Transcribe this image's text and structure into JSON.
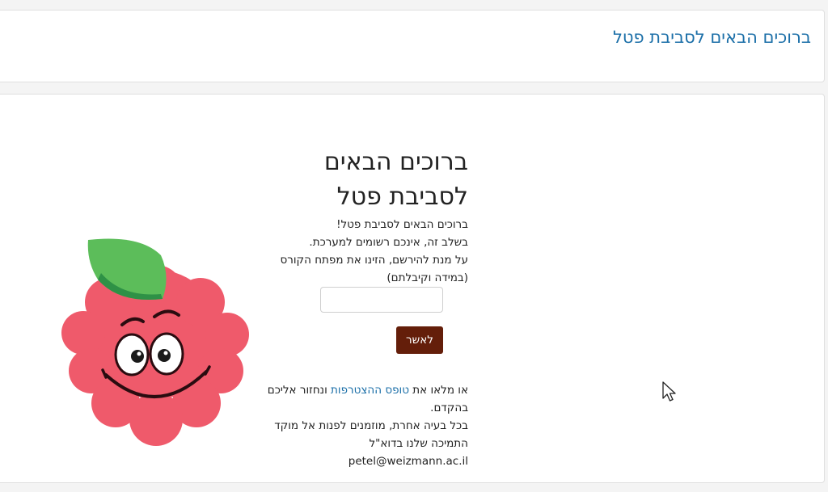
{
  "header": {
    "title": "ברוכים הבאים לסביבת פטל"
  },
  "welcome": {
    "heading_line1": "ברוכים הבאים",
    "heading_line2": "לסביבת פטל",
    "intro_lines": [
      "ברוכים הבאים לסביבת פטל!",
      "בשלב זה, אינכם רשומים למערכת.",
      "על מנת להירשם, הזינו את מפתח הקורס",
      "(במידה וקיבלתם)"
    ]
  },
  "form": {
    "course_key_value": "",
    "confirm_label": "לאשר"
  },
  "footer": {
    "line1_before": "או מלאו את ",
    "join_link": "טופס ההצטרפות",
    "line1_after": " ונחזור אליכם",
    "line2": "בהקדם.",
    "line3": "בכל בעיה אחרת, מוזמנים לפנות אל מוקד",
    "line4": "התמיכה שלנו בדוא\"ל",
    "email": "petel@weizmann.ac.il"
  },
  "icons": {
    "mascot": "raspberry-mascot",
    "cursor": "mouse-pointer"
  },
  "colors": {
    "link": "#1b6fa8",
    "button": "#641e0a",
    "raspberry": "#ef5a6b",
    "leaf": "#5cbd5a"
  }
}
